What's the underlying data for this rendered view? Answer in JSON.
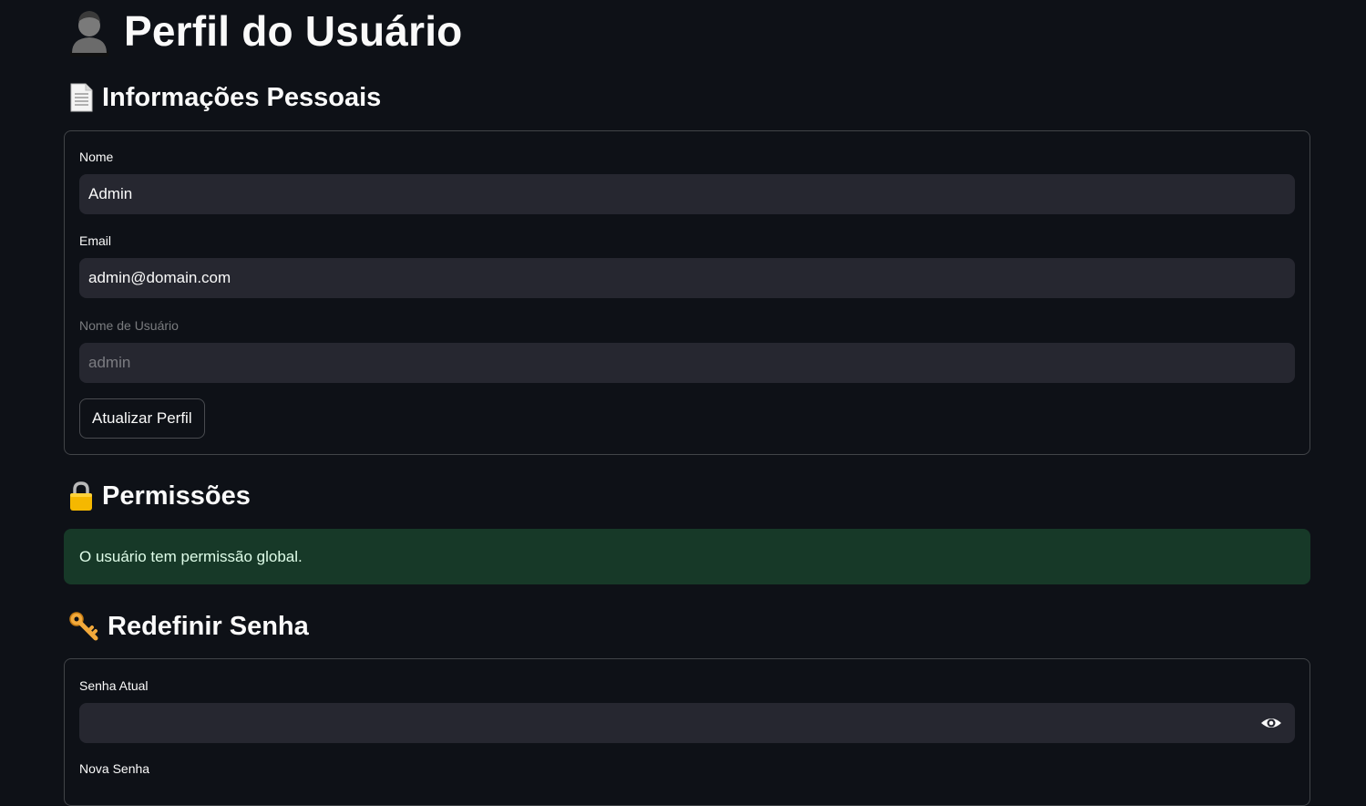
{
  "page": {
    "title": "Perfil do Usuário",
    "title_icon": "user-silhouette-icon"
  },
  "personal_info": {
    "heading": "Informações Pessoais",
    "heading_icon": "document-icon",
    "name_label": "Nome",
    "name_value": "Admin",
    "email_label": "Email",
    "email_value": "admin@domain.com",
    "username_label": "Nome de Usuário",
    "username_value": "admin",
    "update_button": "Atualizar Perfil"
  },
  "permissions": {
    "heading": "Permissões",
    "heading_icon": "lock-icon",
    "message": "O usuário tem permissão global."
  },
  "reset_password": {
    "heading": "Redefinir Senha",
    "heading_icon": "key-icon",
    "current_label": "Senha Atual",
    "current_value": "",
    "new_label": "Nova Senha"
  },
  "colors": {
    "background": "#0e1117",
    "input_bg": "#262730",
    "success_bg": "#173928"
  }
}
